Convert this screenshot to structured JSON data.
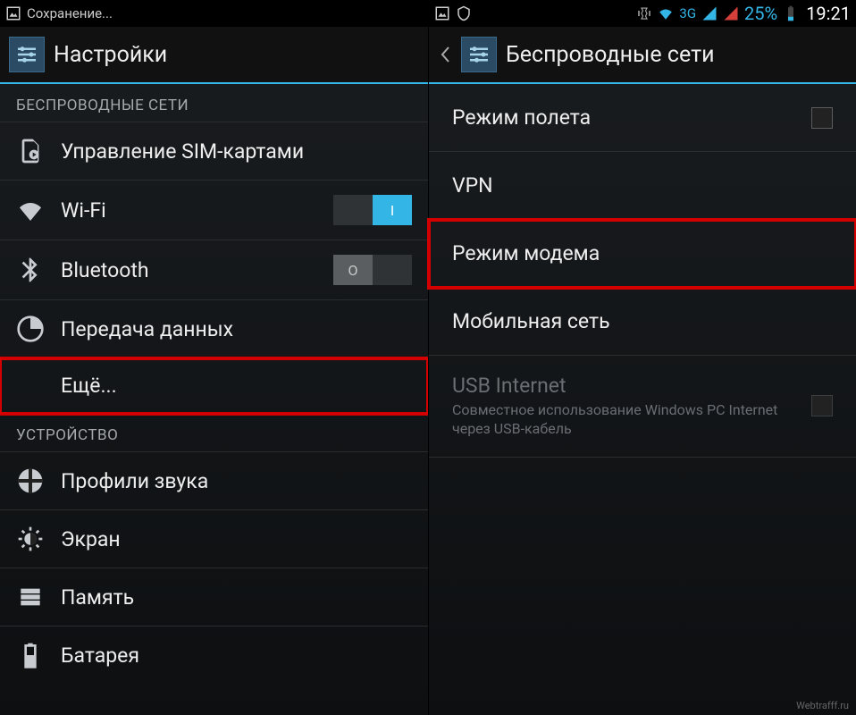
{
  "statusbar_left": {
    "saving_label": "Сохранение..."
  },
  "statusbar_right": {
    "network_label": "3G",
    "battery_pct": "25%",
    "clock": "19:21"
  },
  "left": {
    "title": "Настройки",
    "section_wireless": "БЕСПРОВОДНЫЕ СЕТИ",
    "items": {
      "sim": "Управление SIM-картами",
      "wifi": "Wi-Fi",
      "bluetooth": "Bluetooth",
      "data": "Передача данных",
      "more": "Ещё..."
    },
    "section_device": "УСТРОЙСТВО",
    "device_items": {
      "sound": "Профили звука",
      "display": "Экран",
      "storage": "Память",
      "battery": "Батарея"
    },
    "toggle_on": "I",
    "toggle_off": "O"
  },
  "right": {
    "title": "Беспроводные сети",
    "items": {
      "airplane": "Режим полета",
      "vpn": "VPN",
      "tether": "Режим модема",
      "mobile": "Мобильная сеть",
      "usb_title": "USB Internet",
      "usb_sub": "Совместное использование Windows PC Internet через USB-кабель"
    }
  },
  "watermark": "Webtrafff.ru"
}
